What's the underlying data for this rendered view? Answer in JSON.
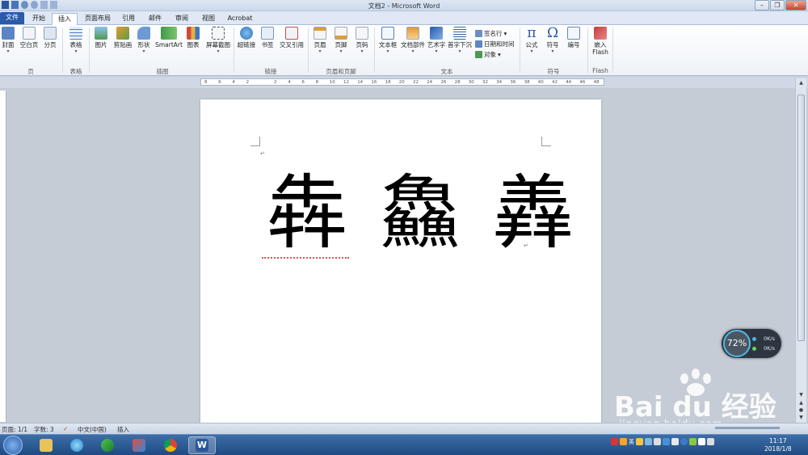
{
  "window": {
    "title": "文档2 - Microsoft Word",
    "controls": {
      "minimize": "–",
      "restore": "❐",
      "close": "✕"
    }
  },
  "tabs": [
    "文件",
    "开始",
    "插入",
    "页面布局",
    "引用",
    "邮件",
    "审阅",
    "视图",
    "Acrobat"
  ],
  "ribbon": {
    "pages": {
      "cover": "封面",
      "blank": "空白页",
      "break": "分页",
      "group": "页"
    },
    "table": {
      "label": "表格",
      "group": "表格"
    },
    "illustrations": {
      "picture": "图片",
      "clipart": "剪贴画",
      "shapes": "形状",
      "smartart": "SmartArt",
      "chart": "图表",
      "screenshot": "屏幕截图",
      "group": "插图"
    },
    "links": {
      "hyperlink": "超链接",
      "bookmark": "书签",
      "crossref": "交叉引用",
      "group": "链接"
    },
    "headerfooter": {
      "header": "页眉",
      "footer": "页脚",
      "pagenum": "页码",
      "group": "页眉和页脚"
    },
    "text": {
      "textbox": "文本框",
      "quickparts": "文档部件",
      "wordart": "艺术字",
      "dropcap": "首字下沉",
      "signature": "签名行",
      "datetime": "日期和时间",
      "object": "对象",
      "group": "文本"
    },
    "symbols": {
      "equation": "公式",
      "symbol": "符号",
      "number": "编号",
      "group": "符号",
      "equation_glyph": "π",
      "symbol_glyph": "Ω"
    },
    "flash": {
      "embed": "嵌入",
      "flash": "Flash",
      "group": "Flash"
    }
  },
  "ruler": {
    "ticks": [
      "8",
      "6",
      "4",
      "2",
      "",
      "2",
      "4",
      "6",
      "8",
      "10",
      "12",
      "14",
      "16",
      "18",
      "20",
      "22",
      "24",
      "26",
      "28",
      "30",
      "32",
      "34",
      "36",
      "38",
      "40",
      "42",
      "44",
      "46",
      "48"
    ]
  },
  "document": {
    "text": "犇 鱻 羴",
    "para_mark": "↵"
  },
  "status": {
    "page": "页面: 1/1",
    "words": "字数: 3",
    "language": "中文(中国)",
    "mode": "插入"
  },
  "net_widget": {
    "percent": "72%",
    "upload": "0K/s",
    "download": "0K/s"
  },
  "watermark": {
    "brand": "Bai du 经验",
    "url": "jingyan.baidu.com"
  },
  "clock": {
    "time": "11:17",
    "date": "2018/1/8"
  },
  "tray_ime": "英"
}
